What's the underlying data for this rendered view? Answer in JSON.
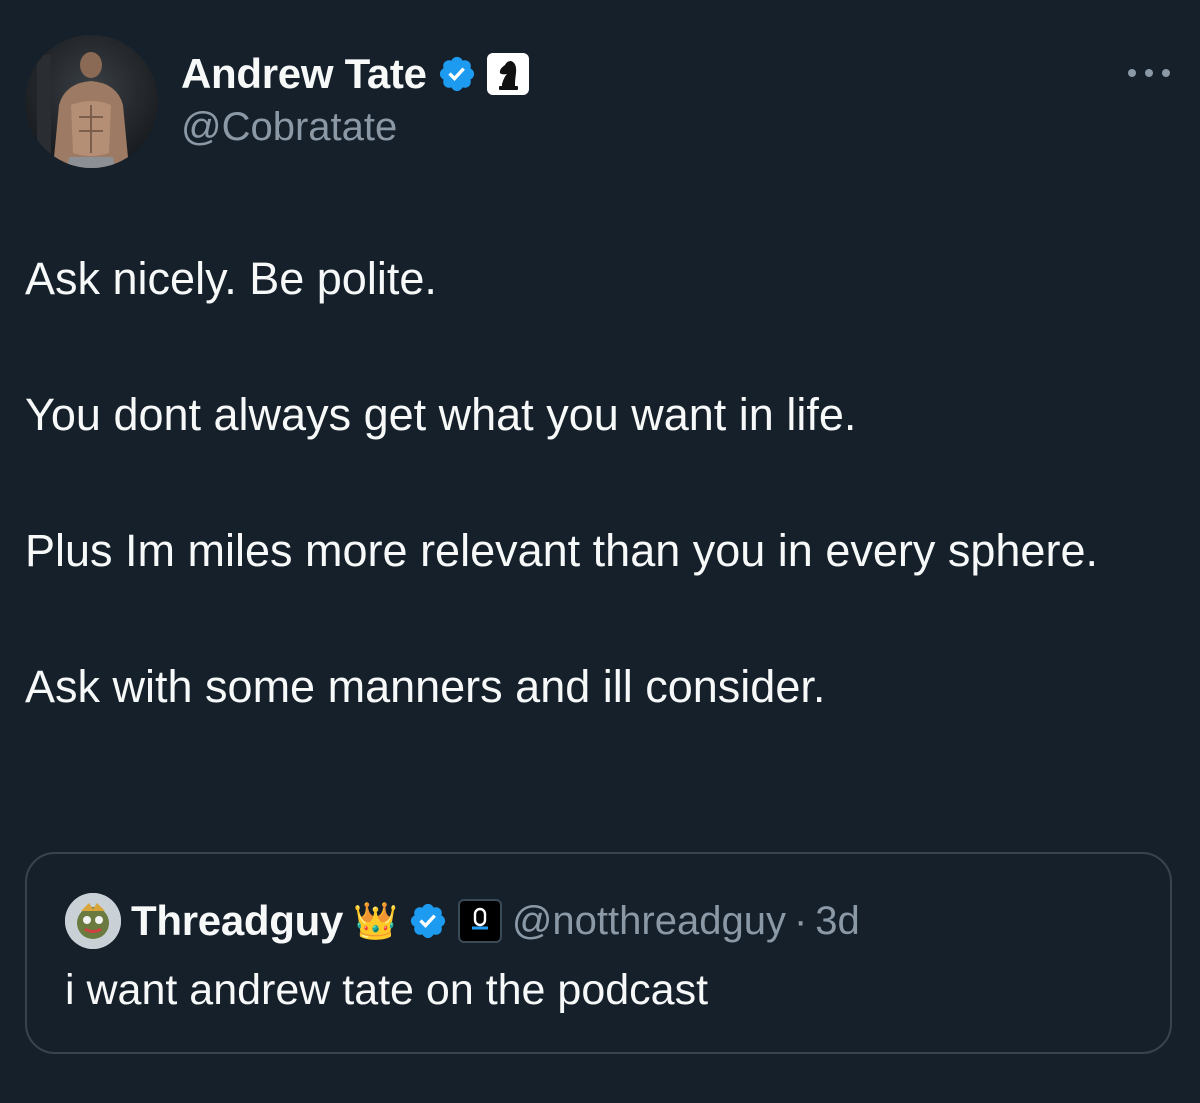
{
  "author": {
    "display_name": "Andrew Tate",
    "handle": "@Cobratate",
    "avatar_icon": "profile-photo",
    "verified_icon": "verified-badge-icon",
    "affiliate_icon": "chess-knight-icon"
  },
  "tweet": {
    "paragraphs": [
      "Ask nicely. Be polite.",
      "You dont always get what you want in life.",
      "Plus Im miles more relevant than you in every sphere.",
      "Ask with some manners and ill consider."
    ]
  },
  "quoted": {
    "display_name": "Threadguy",
    "crown_emoji": "👑",
    "handle": "@notthreadguy",
    "separator": "·",
    "time": "3d",
    "text": "i want andrew tate on the podcast"
  },
  "colors": {
    "background": "#15202b",
    "text": "#f7f9f9",
    "secondary_text": "#8b98a5",
    "verified_blue": "#1d9bf0",
    "border": "#38444d"
  }
}
